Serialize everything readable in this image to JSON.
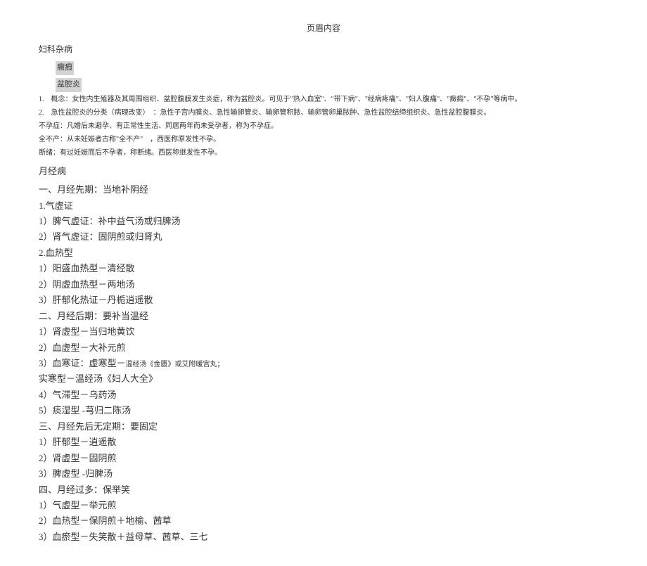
{
  "header": "页眉内容",
  "mainTitle": "妇科杂病",
  "highlightedItems": [
    "癥瘕",
    "盆腔炎"
  ],
  "introLines": [
    "1.　概念：女性内生殖器及其周围组织、盆腔腹膜发生炎症，称为盆腔炎。可见于\"热入血室\"、\"带下病\"、\"经病疼痛\"、\"妇人腹痛\"、\"癥瘕\"、\"不孕\"等病中。",
    "2.　急性盆腔炎的分类（病理改变）　：急性子宫内膜炎、急性输卵管炎、输卵管积脓、输卵管卵巢脓肿、急性盆腔结缔组织炎、急性盆腔腹膜炎。",
    "不孕症：凡婚后未避孕、有正常性生活、同居两年而未受孕者，称为不孕症。",
    "全不产：从未妊娠者古称\"全不产\"　，西医称原发性不孕。",
    "断绪：有过妊娠而后不孕者，称断绪。西医称继发性不孕。"
  ],
  "sectionHeading": "月经病",
  "contentLines": [
    {
      "text": "一、月经先期：当地补阴经"
    },
    {
      "text": "1.气虚证"
    },
    {
      "text": "1）脾气虚证：补中益气汤或归脾汤"
    },
    {
      "text": "2）肾气虚证：固阴煎或归肾丸"
    },
    {
      "text": "2.血热型"
    },
    {
      "text": "1）阳盛血热型－清经散"
    },
    {
      "text": "2）阴虚血热型－两地汤"
    },
    {
      "text": "3）肝郁化热证－丹栀逍遥散"
    },
    {
      "text": "二、月经后期：要补当温经"
    },
    {
      "text": "1）肾虚型－当归地黄饮"
    },
    {
      "text": "2）血虚型－大补元煎"
    },
    {
      "text": "3）血寒证：虚寒型－",
      "suffix": "温经汤《金匮》或艾附暖宫丸；"
    },
    {
      "text": "实寒型－温经汤《妇人大全》"
    },
    {
      "text": "4）气滞型－乌药汤"
    },
    {
      "text": "5）痰湿型 -芎归二陈汤"
    },
    {
      "text": "三、月经先后无定期：要固定"
    },
    {
      "text": "1）肝郁型－逍遥散"
    },
    {
      "text": "2）肾虚型－固阴煎"
    },
    {
      "text": "3）脾虚型 -归脾汤"
    },
    {
      "text": "四、月经过多：保举笑"
    },
    {
      "text": "1）气虚型－举元煎"
    },
    {
      "text": "2）血热型－保阴煎＋地榆、茜草"
    },
    {
      "text": "3）血瘀型－失笑散＋益母草、茜草、三七"
    }
  ]
}
